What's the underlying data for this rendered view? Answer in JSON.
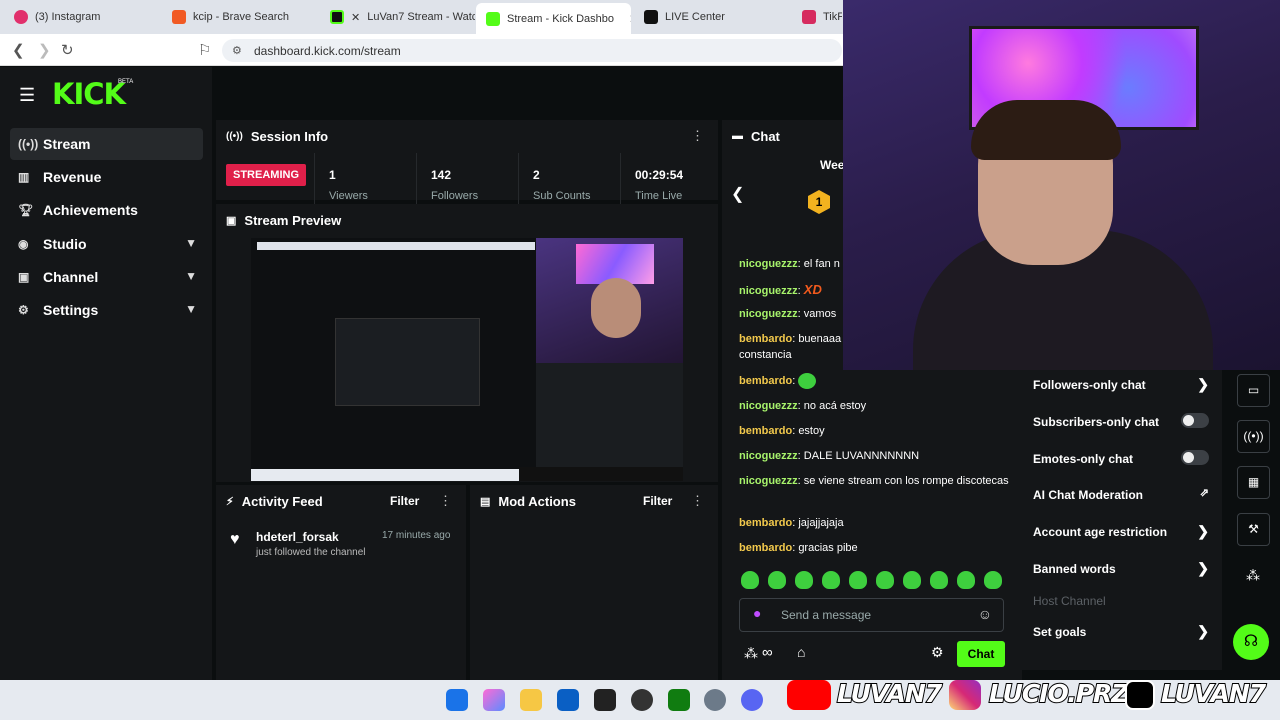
{
  "browser": {
    "tabs": [
      {
        "title": "(3) Instagram",
        "color": "#e1306c"
      },
      {
        "title": "kcip - Brave Search",
        "color": "#f15a24"
      },
      {
        "title": "LuVan7 Stream - Watc",
        "color": "#53fc18"
      },
      {
        "title": "Stream - Kick Dashbo",
        "color": "#53fc18",
        "active": true
      },
      {
        "title": "LIVE Center",
        "color": "#111111"
      },
      {
        "title": "TikFi",
        "color": "#d62b5f"
      }
    ],
    "url": "dashboard.kick.com/stream"
  },
  "kick": {
    "logo": "KICK",
    "logo_badge": "BETA",
    "accent": "#53fc18",
    "sidebar": {
      "items": [
        {
          "label": "Stream",
          "icon": "stream-icon",
          "active": true
        },
        {
          "label": "Revenue",
          "icon": "revenue-icon"
        },
        {
          "label": "Achievements",
          "icon": "trophy-icon"
        },
        {
          "label": "Studio",
          "icon": "studio-icon",
          "expandable": true
        },
        {
          "label": "Channel",
          "icon": "channel-icon",
          "expandable": true
        },
        {
          "label": "Settings",
          "icon": "gear-icon",
          "expandable": true
        }
      ]
    },
    "session_info": {
      "title": "Session Info",
      "status": "STREAMING",
      "stats": [
        {
          "value": "1",
          "label": "Viewers"
        },
        {
          "value": "142",
          "label": "Followers"
        },
        {
          "value": "2",
          "label": "Sub Counts"
        },
        {
          "value": "00:29:54",
          "label": "Time Live"
        }
      ]
    },
    "stream_preview": {
      "title": "Stream Preview"
    },
    "activity_feed": {
      "title": "Activity Feed",
      "filter": "Filter",
      "items": [
        {
          "user": "hdeterl_forsak",
          "time": "17 minutes ago",
          "action": "just followed the channel"
        }
      ]
    },
    "mod_actions": {
      "title": "Mod Actions",
      "filter": "Filter"
    },
    "chat": {
      "title": "Chat",
      "goal_label": "Wee",
      "messages": [
        {
          "user": "nicoguezzz",
          "text": "el fan n",
          "color": "nico"
        },
        {
          "user": "nicoguezzz",
          "text": "XD",
          "color": "nico",
          "emote": true
        },
        {
          "user": "nicoguezzz",
          "text": "vamos",
          "color": "nico"
        },
        {
          "user": "bembardo",
          "text": "buenaaa constancia",
          "color": "bem"
        },
        {
          "user": "bembardo",
          "text": "",
          "color": "bem",
          "emote_only": true
        },
        {
          "user": "nicoguezzz",
          "text": "no acá estoy",
          "color": "nico"
        },
        {
          "user": "bembardo",
          "text": "estoy",
          "color": "bem"
        },
        {
          "user": "nicoguezzz",
          "text": "DALE LUVANNNNNNN",
          "color": "nico"
        },
        {
          "user": "nicoguezzz",
          "text": "se viene stream con los rompe discotecas",
          "color": "nico"
        },
        {
          "user": "bembardo",
          "text": "jajajjajaja",
          "color": "bem"
        },
        {
          "user": "bembardo",
          "text": "gracias pibe",
          "color": "bem"
        }
      ],
      "input_placeholder": "Send a message",
      "send_label": "Chat",
      "emote_count": 10
    },
    "mod_menu": {
      "items": [
        {
          "label": "Followers-only chat",
          "kind": "arrow"
        },
        {
          "label": "Subscribers-only chat",
          "kind": "toggle"
        },
        {
          "label": "Emotes-only chat",
          "kind": "toggle"
        },
        {
          "label": "AI Chat Moderation",
          "kind": "external"
        },
        {
          "label": "Account age restriction",
          "kind": "arrow"
        },
        {
          "label": "Banned words",
          "kind": "arrow"
        },
        {
          "label": "Host Channel",
          "kind": "disabled"
        },
        {
          "label": "Set goals",
          "kind": "arrow"
        }
      ]
    }
  },
  "overlay": {
    "socials": [
      {
        "platform": "youtube-icon",
        "handle": "LUVAN7",
        "color": "#ff0000"
      },
      {
        "platform": "instagram-icon",
        "handle": "LUCIO.PRZ",
        "color": "#d6249f"
      },
      {
        "platform": "tiktok-icon",
        "handle": "LUVAN7",
        "color": "#000000"
      }
    ]
  }
}
